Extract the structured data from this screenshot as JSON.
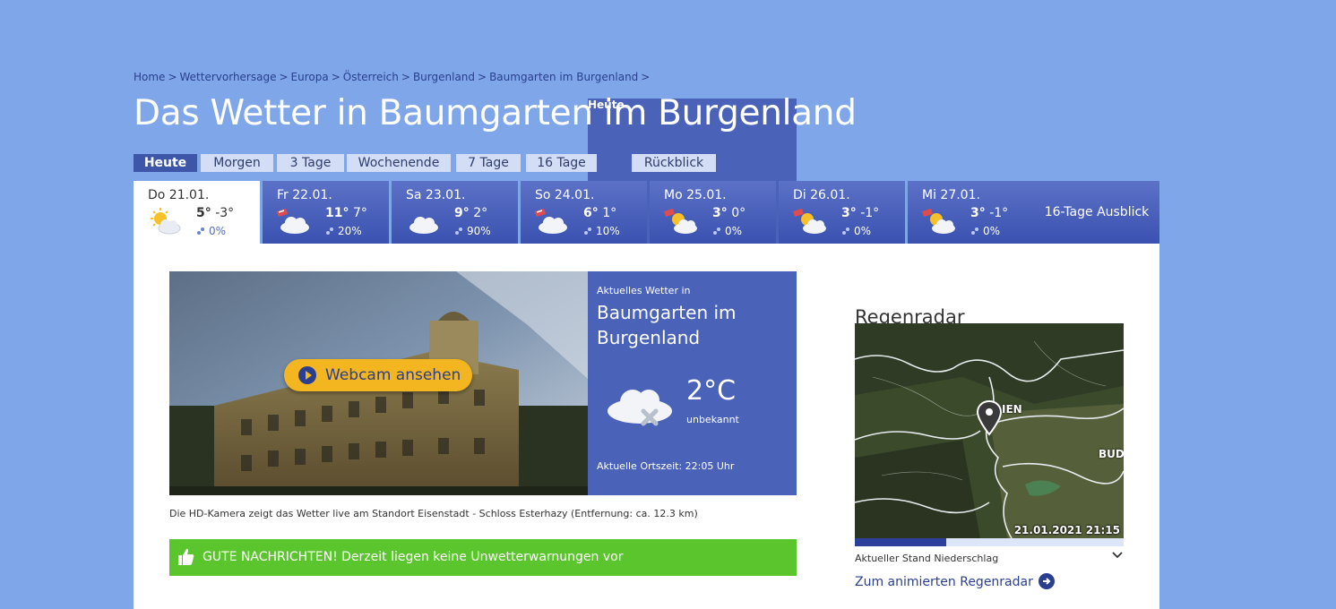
{
  "breadcrumb": {
    "items": [
      "Home",
      "Wettervorhersage",
      "Europa",
      "Österreich",
      "Burgenland",
      "Baumgarten im Burgenland"
    ],
    "current": "Heute",
    "separator": ">"
  },
  "title": "Das Wetter in Baumgarten im Burgenland",
  "tabs": [
    {
      "label": "Heute",
      "active": true
    },
    {
      "label": "Morgen"
    },
    {
      "label": "3 Tage"
    },
    {
      "label": "Wochenende"
    },
    {
      "label": "7 Tage"
    },
    {
      "label": "16 Tage"
    },
    {
      "label": "Rückblick"
    }
  ],
  "days": [
    {
      "name": "Do 21.01.",
      "max": "5°",
      "min": "-3°",
      "rain": "0%",
      "icon": "sun-cloud-icon"
    },
    {
      "name": "Fr 22.01.",
      "max": "11°",
      "min": "7°",
      "rain": "20%",
      "icon": "wind-cloud-icon"
    },
    {
      "name": "Sa 23.01.",
      "max": "9°",
      "min": "2°",
      "rain": "90%",
      "icon": "cloud-icon"
    },
    {
      "name": "So 24.01.",
      "max": "6°",
      "min": "1°",
      "rain": "10%",
      "icon": "wind-cloud-icon"
    },
    {
      "name": "Mo 25.01.",
      "max": "3°",
      "min": "0°",
      "rain": "0%",
      "icon": "wind-sun-cloud-icon"
    },
    {
      "name": "Di 26.01.",
      "max": "3°",
      "min": "-1°",
      "rain": "0%",
      "icon": "wind-sun-cloud-icon"
    },
    {
      "name": "Mi 27.01.",
      "max": "3°",
      "min": "-1°",
      "rain": "0%",
      "icon": "wind-sun-cloud-icon"
    }
  ],
  "outlook_label": "16-Tage Ausblick",
  "webcam": {
    "button_label": "Webcam ansehen",
    "caption": "Die HD-Kamera zeigt das Wetter live am Standort Eisenstadt - Schloss Esterhazy (Entfernung: ca. 12.3 km)"
  },
  "current": {
    "kicker": "Aktuelles Wetter in",
    "place": "Baumgarten im Burgenland",
    "temp": "2°C",
    "condition": "unbekannt",
    "local_time": "Aktuelle Ortszeit: 22:05 Uhr",
    "icon": "cloud-unknown-icon"
  },
  "alert": {
    "text": "GUTE NACHRICHTEN! Derzeit liegen keine Unwetterwarnungen vor",
    "color": "#5bc52e"
  },
  "radar": {
    "title": "Regenradar",
    "timestamp": "21.01.2021 21:15",
    "map_label_vienna": "IEN",
    "map_label_budapest": "BUD",
    "status": "Aktueller Stand Niederschlag",
    "progress": 0.34,
    "link": "Zum animierten Regenradar"
  },
  "colors": {
    "background": "#7fa6e8",
    "accent": "#2a3f8f",
    "panel": "#4a63b8"
  }
}
